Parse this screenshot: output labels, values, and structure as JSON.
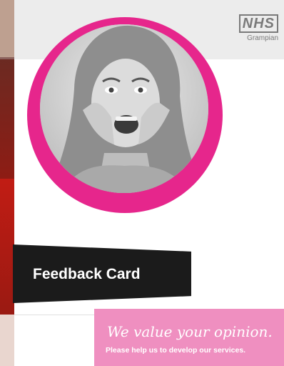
{
  "logo": {
    "brand": "NHS",
    "region": "Grampian"
  },
  "card": {
    "title": "Feedback Card",
    "tagline": "We value your opinion.",
    "subline": "Please help us to develop our services."
  },
  "colors": {
    "accent_pink": "#e6268c",
    "panel_pink": "#ef8fc0",
    "banner_black": "#1b1b1b"
  },
  "image": {
    "subject": "woman-shouting-photo"
  }
}
